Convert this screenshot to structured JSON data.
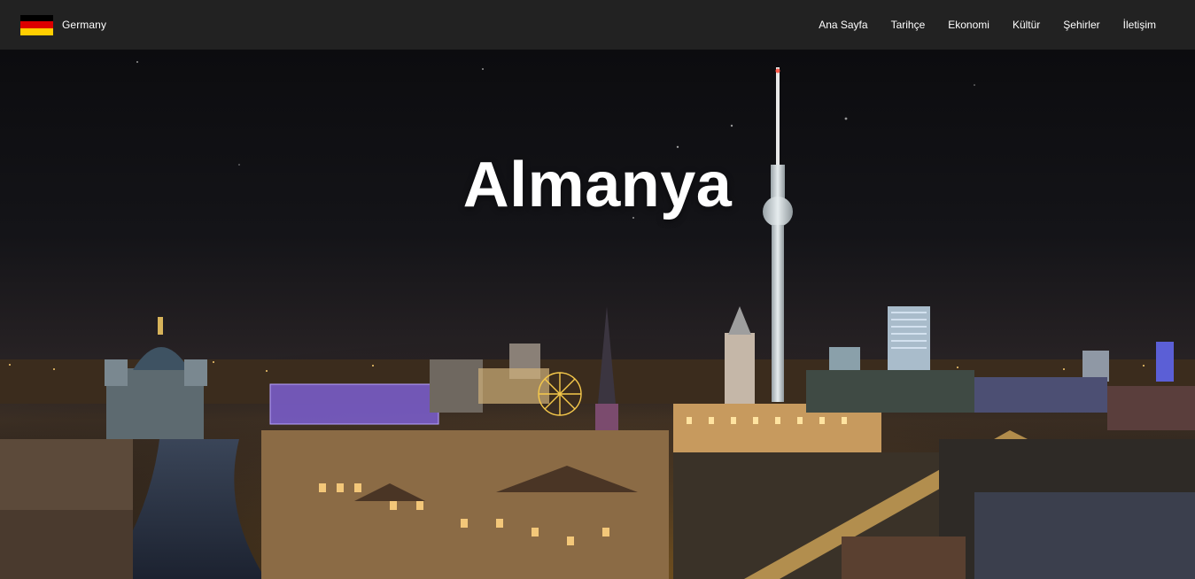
{
  "brand": {
    "name": "Germany",
    "flag_colors": [
      "#000000",
      "#dd0000",
      "#ffce00"
    ]
  },
  "nav": {
    "items": [
      {
        "label": "Ana Sayfa"
      },
      {
        "label": "Tarihçe"
      },
      {
        "label": "Ekonomi"
      },
      {
        "label": "Kültür"
      },
      {
        "label": "Şehirler"
      },
      {
        "label": "İletişim"
      }
    ]
  },
  "hero": {
    "title": "Almanya",
    "background_image": "berlin-night-skyline-photo"
  },
  "colors": {
    "navbar_bg": "#222222",
    "nav_text": "#ffffff",
    "hero_title": "#ffffff"
  }
}
